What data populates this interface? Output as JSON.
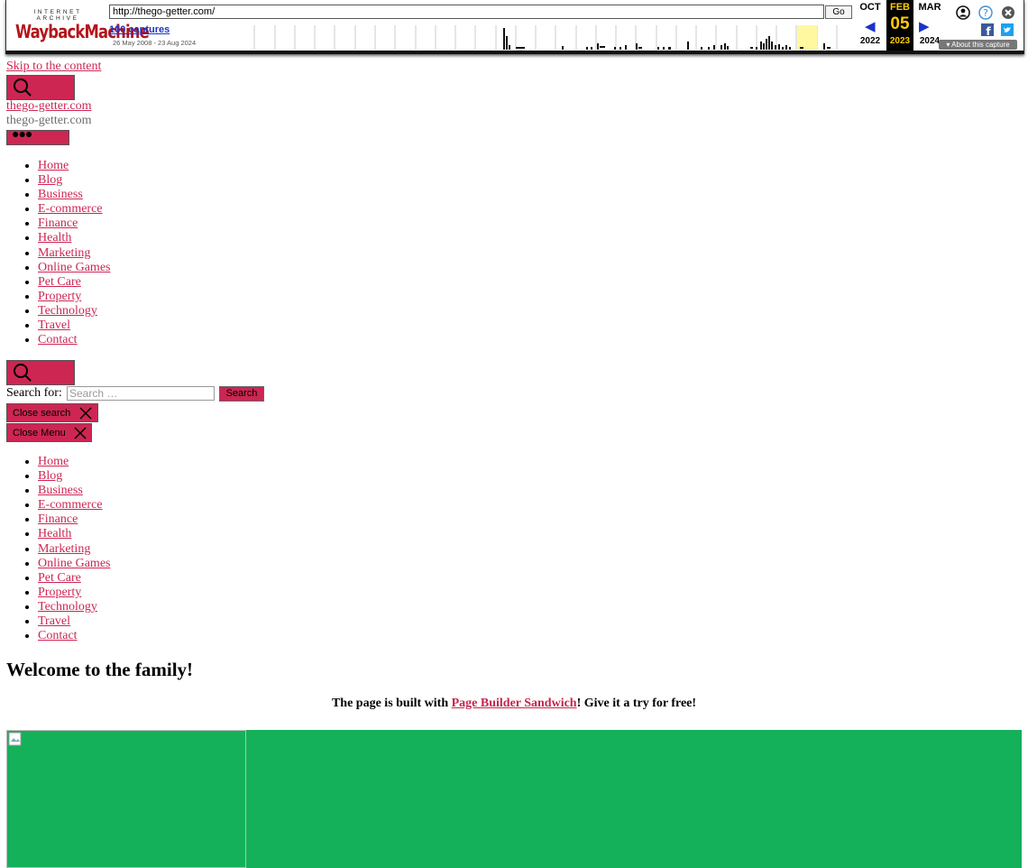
{
  "wayback": {
    "logo_top": "INTERNET ARCHIVE",
    "logo_main": "WaybackMachine",
    "url": "http://thego-getter.com/",
    "go_label": "Go",
    "captures": "100 captures",
    "range": "26 May 2008 - 23 Aug 2024",
    "prev_month": "OCT",
    "cur_month": "FEB",
    "next_month": "MAR",
    "prev_year": "2022",
    "cur_day": "05",
    "cur_year": "2023",
    "next_year": "2024",
    "about": "About this capture"
  },
  "header": {
    "skip_link": "Skip to the content",
    "search_toggle": "Search",
    "site_title": "thego-getter.com",
    "site_description": "thego-getter.com",
    "menu_toggle": "Menu"
  },
  "nav": {
    "items": [
      "Home",
      "Blog",
      "Business",
      "E-commerce",
      "Finance",
      "Health",
      "Marketing",
      "Online Games",
      "Pet Care",
      "Property",
      "Technology",
      "Travel",
      "Contact"
    ]
  },
  "search": {
    "toggle_label": "Search",
    "label": "Search for:",
    "placeholder": "Search …",
    "submit": "Search",
    "close": "Close search"
  },
  "menu_modal": {
    "close": "Close Menu",
    "items": [
      "Home",
      "Blog",
      "Business",
      "E-commerce",
      "Finance",
      "Health",
      "Marketing",
      "Online Games",
      "Pet Care",
      "Property",
      "Technology",
      "Travel",
      "Contact"
    ]
  },
  "content": {
    "title": "Welcome to the family!",
    "built_prefix": "The page is built with ",
    "built_link": "Page Builder Sandwich",
    "built_suffix": "! Give it a try for free!",
    "hero_color": "#14b15a"
  }
}
